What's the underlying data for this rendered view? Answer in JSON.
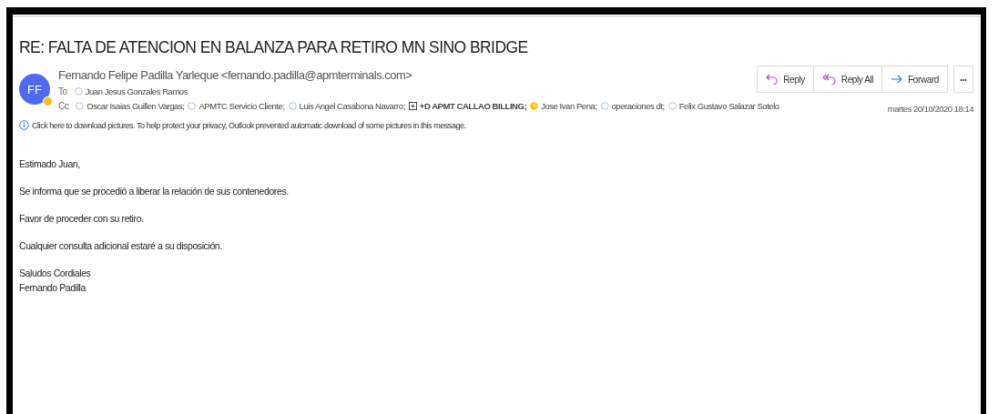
{
  "subject": "RE: FALTA DE ATENCION EN BALANZA PARA RETIRO MN SINO BRIDGE",
  "sender": {
    "initials": "FF",
    "away": true,
    "display": "Fernando Felipe Padilla Yarleque <fernando.padilla@apmterminals.com>"
  },
  "to": {
    "label": "To",
    "recipients": [
      {
        "kind": "contact",
        "name": "Juan Jesus Gonzales Ramos"
      }
    ]
  },
  "cc": {
    "label": "Cc",
    "recipients": [
      {
        "kind": "contact",
        "name": "Oscar Isaias Guillen Vargas;"
      },
      {
        "kind": "contact",
        "name": "APMTC Servicio Cliente;"
      },
      {
        "kind": "contact",
        "name": "Luis Angel Casabona Navarro;"
      },
      {
        "kind": "group",
        "name": "+D APMT CALLAO BILLING;"
      },
      {
        "kind": "away",
        "name": "Jose Ivan Pena;"
      },
      {
        "kind": "contact",
        "name": "operaciones dt;"
      },
      {
        "kind": "contact",
        "name": "Felix Gustavo Salazar Sotelo"
      }
    ]
  },
  "info_bar": "Click here to download pictures. To help protect your privacy, Outlook prevented automatic download of some pictures in this message.",
  "actions": [
    {
      "kind": "reply",
      "label": "Reply"
    },
    {
      "kind": "reply-all",
      "label": "Reply All"
    },
    {
      "kind": "forward",
      "label": "Forward"
    }
  ],
  "more": "•••",
  "date": "martes 20/10/2020 18:14",
  "body": [
    [
      "Estimado Juan,"
    ],
    [
      "Se informa que se procedió a liberar la relación de sus contenedores."
    ],
    [
      "Favor de proceder con su retiro."
    ],
    [
      "Cualquier consulta adicional estaré a su disposición."
    ],
    [
      "Saludos Cordiales",
      "Fernando Padilla"
    ]
  ]
}
